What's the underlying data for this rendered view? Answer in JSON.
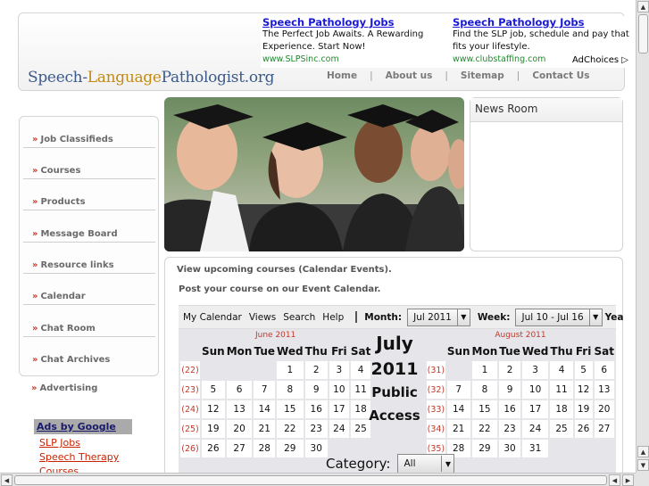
{
  "site": {
    "logo_part1": "Speech-",
    "logo_part2": "Language",
    "logo_part3": "Pathologist.org"
  },
  "nav": [
    {
      "label": "Home"
    },
    {
      "label": "About us"
    },
    {
      "label": "Sitemap"
    },
    {
      "label": "Contact Us"
    }
  ],
  "ads": [
    {
      "title": "Speech Pathology Jobs",
      "desc": "The Perfect Job Awaits. A Rewarding Experience. Start Now!",
      "url": "www.SLPSinc.com"
    },
    {
      "title": "Speech Pathology Jobs",
      "desc": "Find the SLP job, schedule and pay that fits your lifestyle.",
      "url": "www.clubstaffing.com"
    }
  ],
  "adchoices": "AdChoices",
  "sidebar": [
    {
      "label": "Job Classifieds"
    },
    {
      "label": "Courses"
    },
    {
      "label": "Products"
    },
    {
      "label": "Message Board"
    },
    {
      "label": "Resource links"
    },
    {
      "label": "Calendar"
    },
    {
      "label": "Chat Room"
    },
    {
      "label": "Chat Archives"
    }
  ],
  "advertising": "Advertising",
  "ads_by_google": {
    "heading": "Ads by Google",
    "links": [
      "SLP Jobs",
      "Speech Therapy",
      "Courses"
    ]
  },
  "newsroom": {
    "title": "News Room"
  },
  "main": {
    "line1": "View upcoming courses (Calendar Events).",
    "line2": "Post your course on our Event Calendar."
  },
  "calendar": {
    "toolbar": {
      "my_calendar": "My Calendar",
      "views": "Views",
      "search": "Search",
      "help": "Help",
      "month_label": "Month:",
      "month_value": "Jul 2011",
      "week_label": "Week:",
      "week_value": "Jul 10 - Jul 16",
      "year_label": "Yea"
    },
    "weekdays": [
      "Sun",
      "Mon",
      "Tue",
      "Wed",
      "Thu",
      "Fri",
      "Sat"
    ],
    "center": {
      "month": "July",
      "year": "2011",
      "line1": "Public",
      "line2": "Access"
    },
    "june": {
      "name": "June 2011",
      "rows": [
        {
          "wk": "(22)",
          "days": [
            "",
            "",
            "",
            "1",
            "2",
            "3",
            "4"
          ]
        },
        {
          "wk": "(23)",
          "days": [
            "5",
            "6",
            "7",
            "8",
            "9",
            "10",
            "11"
          ]
        },
        {
          "wk": "(24)",
          "days": [
            "12",
            "13",
            "14",
            "15",
            "16",
            "17",
            "18"
          ]
        },
        {
          "wk": "(25)",
          "days": [
            "19",
            "20",
            "21",
            "22",
            "23",
            "24",
            "25"
          ]
        },
        {
          "wk": "(26)",
          "days": [
            "26",
            "27",
            "28",
            "29",
            "30",
            "",
            ""
          ]
        }
      ]
    },
    "august": {
      "name": "August 2011",
      "rows": [
        {
          "wk": "(31)",
          "days": [
            "",
            "1",
            "2",
            "3",
            "4",
            "5",
            "6"
          ]
        },
        {
          "wk": "(32)",
          "days": [
            "7",
            "8",
            "9",
            "10",
            "11",
            "12",
            "13"
          ]
        },
        {
          "wk": "(33)",
          "days": [
            "14",
            "15",
            "16",
            "17",
            "18",
            "19",
            "20"
          ]
        },
        {
          "wk": "(34)",
          "days": [
            "21",
            "22",
            "23",
            "24",
            "25",
            "26",
            "27"
          ]
        },
        {
          "wk": "(35)",
          "days": [
            "28",
            "29",
            "30",
            "31",
            "",
            "",
            ""
          ]
        }
      ]
    },
    "category_label": "Category:",
    "category_value": "All"
  }
}
